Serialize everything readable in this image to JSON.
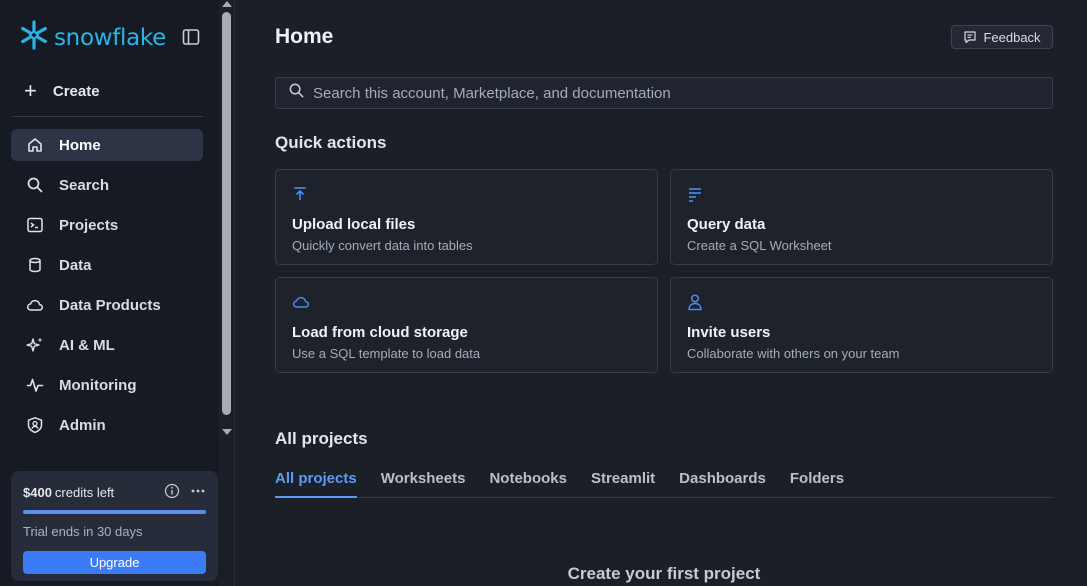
{
  "brand": {
    "name": "snowflake",
    "color": "#29b5e8"
  },
  "sidebar": {
    "create_label": "Create",
    "items": [
      {
        "label": "Home",
        "icon": "home-icon",
        "active": true
      },
      {
        "label": "Search",
        "icon": "search-icon"
      },
      {
        "label": "Projects",
        "icon": "terminal-icon"
      },
      {
        "label": "Data",
        "icon": "database-icon"
      },
      {
        "label": "Data Products",
        "icon": "cloud-icon"
      },
      {
        "label": "AI & ML",
        "icon": "sparkle-icon"
      },
      {
        "label": "Monitoring",
        "icon": "activity-icon"
      },
      {
        "label": "Admin",
        "icon": "shield-user-icon"
      }
    ],
    "credits": {
      "amount": "$400",
      "amount_suffix": "credits left",
      "progress_fraction": 1.0,
      "trial_text": "Trial ends in 30 days",
      "upgrade_label": "Upgrade"
    }
  },
  "header": {
    "title": "Home",
    "feedback_label": "Feedback"
  },
  "search": {
    "placeholder": "Search this account, Marketplace, and documentation"
  },
  "quick_actions": {
    "title": "Quick actions",
    "cards": [
      {
        "title": "Upload local files",
        "desc": "Quickly convert data into tables",
        "icon": "upload-icon"
      },
      {
        "title": "Query data",
        "desc": "Create a SQL Worksheet",
        "icon": "lines-icon"
      },
      {
        "title": "Load from cloud storage",
        "desc": "Use a SQL template to load data",
        "icon": "cloud-icon"
      },
      {
        "title": "Invite users",
        "desc": "Collaborate with others on your team",
        "icon": "user-icon"
      }
    ]
  },
  "projects": {
    "title": "All projects",
    "tabs": [
      "All projects",
      "Worksheets",
      "Notebooks",
      "Streamlit",
      "Dashboards",
      "Folders"
    ],
    "active_tab": 0,
    "empty_title": "Create your first project"
  },
  "colors": {
    "accent": "#5b9bf8",
    "button": "#3b7bf5",
    "icon_blue": "#4a8bf5"
  }
}
